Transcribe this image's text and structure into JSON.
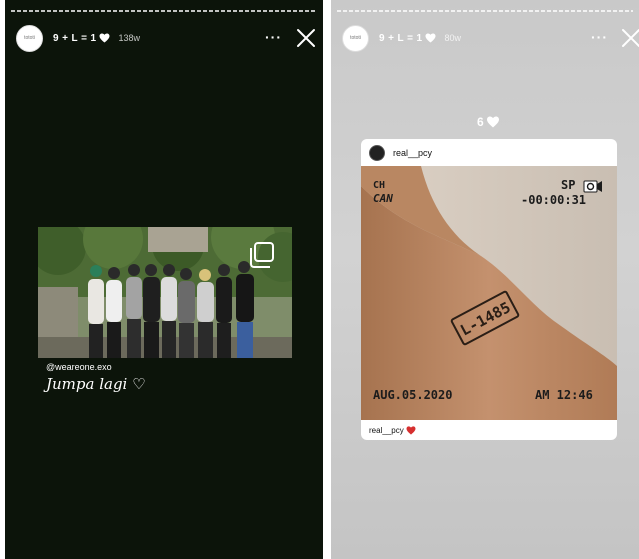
{
  "stories": [
    {
      "username": "9 + L = 1",
      "time_ago": "138w",
      "more_label": "···",
      "mention": "@weareone.exo",
      "caption": "Jumpa lagi ♡"
    },
    {
      "username": "9 + L = 1",
      "time_ago": "80w",
      "more_label": "···",
      "count": "6",
      "card": {
        "username": "real__pcy",
        "footer_username": "real__pcy",
        "vhs": {
          "mode_top": "CH",
          "mode_bottom": "CAN",
          "sp": "SP",
          "timer": "-00:00:31",
          "date": "AUG.05.2020",
          "time": "AM 12:46",
          "tattoo": "L-1485"
        }
      }
    }
  ],
  "colors": {
    "left_bg": "#0c140a",
    "right_bg": "#c9c9c9",
    "heart_white": "#ffffff",
    "heart_red": "#d62f2f",
    "skin": "#c4916e"
  },
  "icons": [
    "white-heart-icon",
    "red-heart-icon",
    "close-icon",
    "more-icon",
    "repost-icon",
    "camera-icon"
  ]
}
